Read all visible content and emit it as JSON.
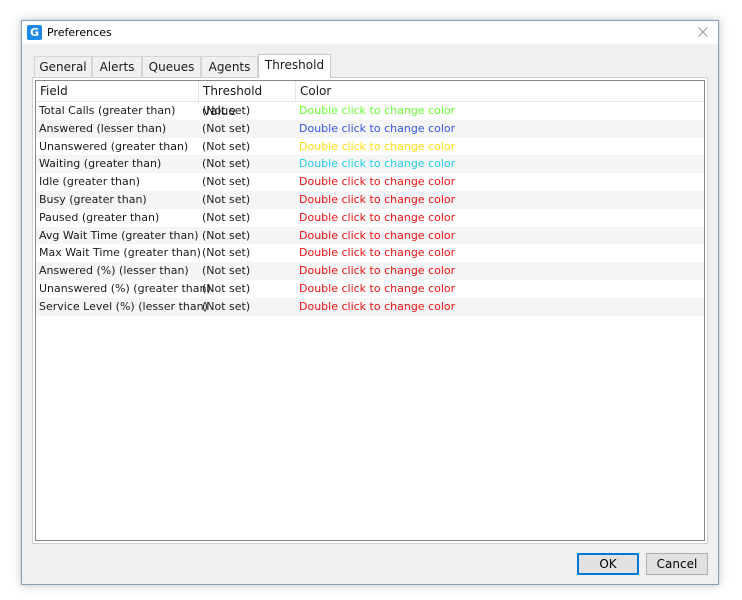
{
  "window": {
    "title": "Preferences",
    "app_icon": "G"
  },
  "tabs": [
    {
      "label": "General"
    },
    {
      "label": "Alerts"
    },
    {
      "label": "Queues"
    },
    {
      "label": "Agents"
    },
    {
      "label": "Threshold"
    }
  ],
  "active_tab": "Threshold",
  "table": {
    "columns": [
      "Field",
      "Threshold value",
      "Color"
    ],
    "rows": [
      {
        "field": "Total Calls (greater than)",
        "value": "(Not set)",
        "color_label": "Double click to change color",
        "color": "#66ff33"
      },
      {
        "field": "Answered (lesser than)",
        "value": "(Not set)",
        "color_label": "Double click to change color",
        "color": "#3355ee"
      },
      {
        "field": "Unanswered (greater than)",
        "value": "(Not set)",
        "color_label": "Double click to change color",
        "color": "#ffdd11"
      },
      {
        "field": "Waiting (greater than)",
        "value": "(Not set)",
        "color_label": "Double click to change color",
        "color": "#22ccee"
      },
      {
        "field": "Idle (greater than)",
        "value": "(Not set)",
        "color_label": "Double click to change color",
        "color": "#ee1111"
      },
      {
        "field": "Busy (greater than)",
        "value": "(Not set)",
        "color_label": "Double click to change color",
        "color": "#ee1111"
      },
      {
        "field": "Paused (greater than)",
        "value": "(Not set)",
        "color_label": "Double click to change color",
        "color": "#ee1111"
      },
      {
        "field": "Avg Wait Time (greater than)",
        "value": "(Not set)",
        "color_label": "Double click to change color",
        "color": "#ee1111"
      },
      {
        "field": "Max Wait Time (greater than)",
        "value": "(Not set)",
        "color_label": "Double click to change color",
        "color": "#ee1111"
      },
      {
        "field": "Answered (%) (lesser than)",
        "value": "(Not set)",
        "color_label": "Double click to change color",
        "color": "#ee1111"
      },
      {
        "field": "Unanswered (%) (greater than)",
        "value": "(Not set)",
        "color_label": "Double click to change color",
        "color": "#ee1111"
      },
      {
        "field": "Service Level (%) (lesser than)",
        "value": "(Not set)",
        "color_label": "Double click to change color",
        "color": "#ee1111"
      }
    ]
  },
  "buttons": {
    "ok_label": "OK",
    "cancel_label": "Cancel"
  },
  "colors": {
    "accent": "#0078d7",
    "app_icon": "#1e88e5"
  }
}
